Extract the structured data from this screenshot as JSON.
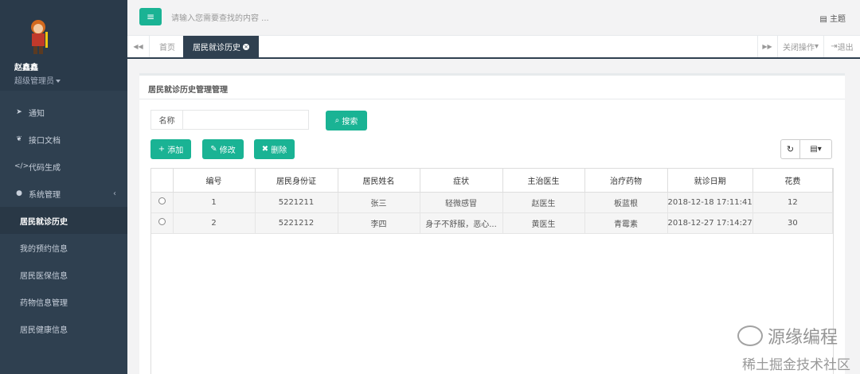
{
  "sidebar": {
    "user_name": "赵鑫鑫",
    "user_role": "超级管理员",
    "items": [
      {
        "label": "通知",
        "icon": "paper-plane-icon"
      },
      {
        "label": "接口文档",
        "icon": "leaf-icon"
      },
      {
        "label": "代码生成",
        "icon": "code-icon"
      },
      {
        "label": "系统管理",
        "icon": "user-icon"
      },
      {
        "label": "居民就诊历史"
      },
      {
        "label": "我的预约信息"
      },
      {
        "label": "居民医保信息"
      },
      {
        "label": "药物信息管理"
      },
      {
        "label": "居民健康信息"
      }
    ]
  },
  "topbar": {
    "search_placeholder": "请输入您需要查找的内容 ...",
    "theme_label": "主题"
  },
  "tabs": {
    "home": "首页",
    "current": "居民就诊历史",
    "close_ops": "关闭操作",
    "logout": "退出"
  },
  "panel": {
    "title": "居民就诊历史管理管理",
    "search_label": "名称",
    "search_button": "搜索",
    "add_button": "添加",
    "edit_button": "修改",
    "delete_button": "删除"
  },
  "table": {
    "headers": [
      "编号",
      "居民身份证",
      "居民姓名",
      "症状",
      "主治医生",
      "治疗药物",
      "就诊日期",
      "花费"
    ],
    "rows": [
      [
        "1",
        "5221211",
        "张三",
        "轻微感冒",
        "赵医生",
        "板蓝根",
        "2018-12-18 17:11:41",
        "12"
      ],
      [
        "2",
        "5221212",
        "李四",
        "身子不舒服，恶心...",
        "黄医生",
        "青霉素",
        "2018-12-27 17:14:27",
        "30"
      ]
    ]
  },
  "watermark": {
    "brand": "源缘编程",
    "community": "稀土掘金技术社区"
  },
  "colors": {
    "sidebar": "#2f4050",
    "accent": "#1ab394"
  }
}
